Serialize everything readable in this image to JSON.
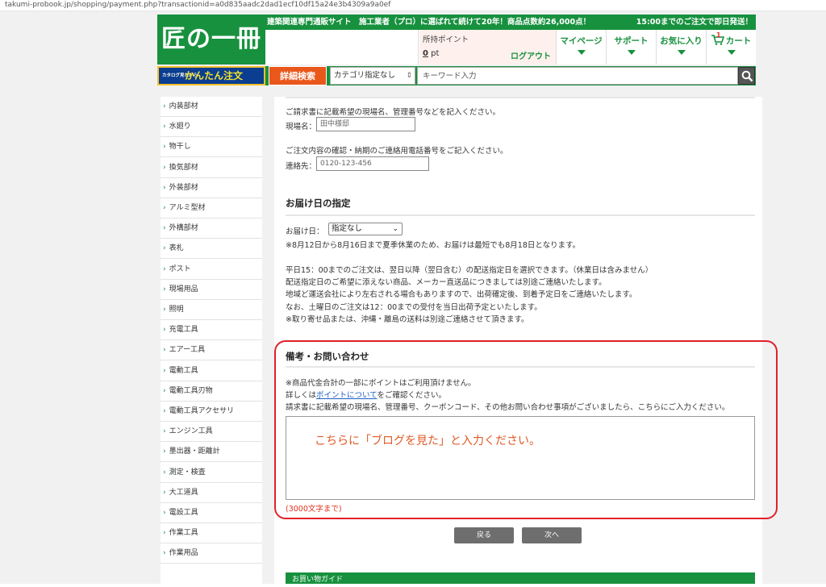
{
  "url": "takumi-probook.jp/shopping/payment.php?transactionid=a0d835aadc2dad1ecf10df15a24e3b4309a9a0ef",
  "header": {
    "logo": "匠の一冊",
    "tagline": "建築関連専門通販サイト　施工業者（プロ）に選ばれて続けて20年！商品点数約26,000点！",
    "shipping_notice": "15:00までのご注文で即日発送！",
    "points_label": "所持ポイント",
    "points_value": "0",
    "points_unit": " pt",
    "logout": "ログアウト",
    "nav": {
      "mypage": "マイページ",
      "support": "サポート",
      "favorites": "お気に入り",
      "cart": "カート",
      "cart_count": "1"
    }
  },
  "search": {
    "easy_order_small": "カタログ見ながら",
    "easy_order": "かんたん注文",
    "advanced": "詳細検索",
    "category": "カテゴリ指定なし",
    "keyword_placeholder": "キーワード入力"
  },
  "sidebar": {
    "items": [
      "内装部材",
      "水廻り",
      "物干し",
      "換気部材",
      "外装部材",
      "アルミ型材",
      "外構部材",
      "表札",
      "ポスト",
      "現場用品",
      "照明",
      "充電工具",
      "エアー工具",
      "電動工具",
      "電動工具刃物",
      "電動工具アクセサリ",
      "エンジン工具",
      "墨出器・距離計",
      "測定・検査",
      "大工道具",
      "電設工具",
      "作業工具",
      "作業用品"
    ]
  },
  "main": {
    "site_note": "ご請求書に記載希望の現場名、管理番号などを記入ください。",
    "site_label": "現場名：",
    "site_value": "田中様邸",
    "contact_note": "ご注文内容の確認・納期のご連絡用電話番号をご記入ください。",
    "contact_label": "連絡先：",
    "contact_value": "0120-123-456",
    "delivery": {
      "title": "お届け日の指定",
      "label": "お届け日：",
      "selected": "指定なし",
      "holiday_note": "※8月12日から8月16日まで夏季休業のため、お届けは最短でも8月18日となります。",
      "notes": [
        "平日15：00までのご注文は、翌日以降（翌日含む）の配送指定日を選択できます。（休業日は含みません）",
        "配送指定日のご希望に添えない商品、メーカー直送品につきましては別途ご連絡いたします。",
        "地域ど運送会社により左右される場合もありますので、出荷確定後、到着予定日をご連絡いたします。",
        "なお、土曜日のご注文は12：00までの受付を当日出荷予定といたします。",
        "※取り寄せ品または、沖縄・離島の送料は別途ご連絡させて頂きます。"
      ]
    },
    "remarks": {
      "title": "備考・お問い合わせ",
      "note1": "※商品代金合計の一部にポイントはご利用頂けません。",
      "note2_pre": "詳しくは",
      "note2_link": "ポイントについて",
      "note2_post": "をご確認ください。",
      "note3": "請求書に記載希望の現場名、管理番号、クーポンコード、その他お問い合わせ事項がございましたら、こちらにご入力ください。",
      "annotation": "こちらに「ブログを見た」と入力ください。",
      "limit": "(3000文字まで)"
    },
    "back": "戻る",
    "next": "次へ",
    "guide": "お買い物ガイド"
  },
  "colors": {
    "brand_green": "#17913e",
    "accent_orange": "#e9571b",
    "highlight_red": "#e1202a"
  }
}
